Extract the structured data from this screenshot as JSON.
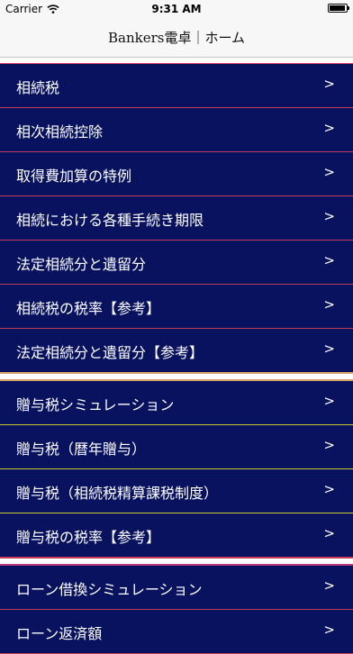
{
  "status_bar": {
    "carrier": "Carrier",
    "time": "9:31 AM"
  },
  "nav": {
    "title": "Bankers電卓｜ホーム"
  },
  "chevron": ">",
  "sections": [
    {
      "items": [
        "相続税",
        "相次相続控除",
        "取得費加算の特例",
        "相続における各種手続き期限",
        "法定相続分と遺留分",
        "相続税の税率【参考】",
        "法定相続分と遺留分【参考】"
      ]
    },
    {
      "items": [
        "贈与税シミュレーション",
        "贈与税（暦年贈与）",
        "贈与税（相続税精算課税制度）",
        "贈与税の税率【参考】"
      ]
    },
    {
      "items": [
        "ローン借換シミュレーション",
        "ローン返済額"
      ]
    }
  ]
}
